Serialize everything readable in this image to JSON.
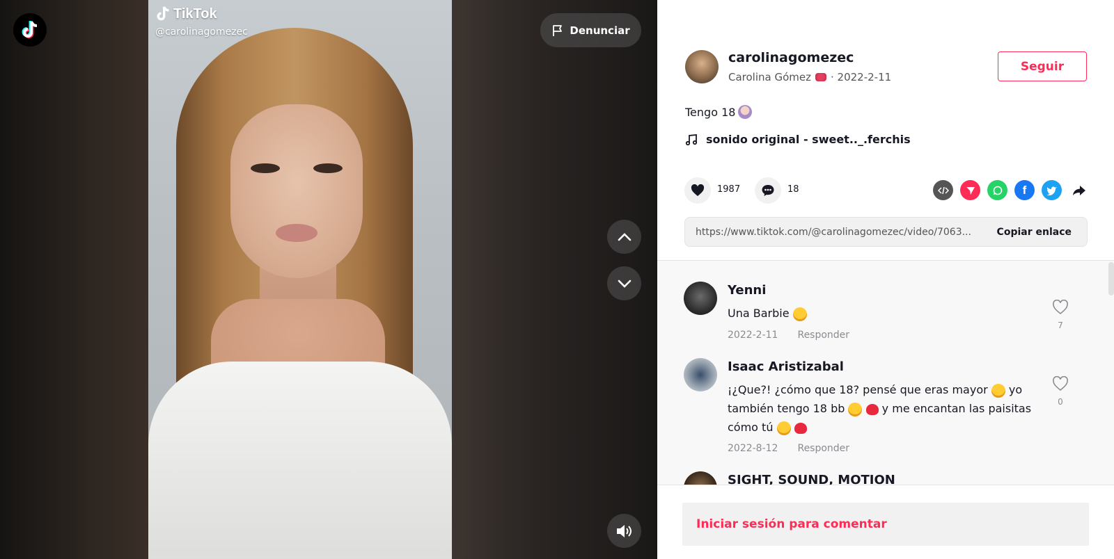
{
  "video": {
    "watermark": {
      "brand": "TikTok",
      "username": "@carolinagomezec"
    },
    "report_label": "Denunciar"
  },
  "author": {
    "username": "carolinagomezec",
    "display_name": "Carolina Gómez",
    "date": "· 2022-2-11",
    "follow_label": "Seguir"
  },
  "post": {
    "caption": "Tengo 18",
    "music": "sonido original - sweet.._.ferchis",
    "likes": "1987",
    "comments_count": "18",
    "link": "https://www.tiktok.com/@carolinagomezec/video/7063...",
    "copy_label": "Copiar enlace"
  },
  "comments": [
    {
      "user": "Yenni",
      "text": "Una Barbie",
      "date": "2022-2-11",
      "reply": "Responder",
      "likes": "7"
    },
    {
      "user": "Isaac Aristizabal",
      "text_l1": "¡¿Que?! ¿cómo que 18? pensé que eras mayor",
      "text_l1b": "yo",
      "text_l2": "también tengo 18 bb",
      "text_l2b": "y me encantan las paisitas",
      "text_l3": "cómo tú",
      "date": "2022-8-12",
      "reply": "Responder",
      "likes": "0"
    },
    {
      "user": "SIGHT, SOUND, MOTION"
    }
  ],
  "login_prompt": "Iniciar sesión para comentar",
  "colors": {
    "accent": "#fe2c55",
    "text": "#161823",
    "muted": "#8a8b91"
  }
}
